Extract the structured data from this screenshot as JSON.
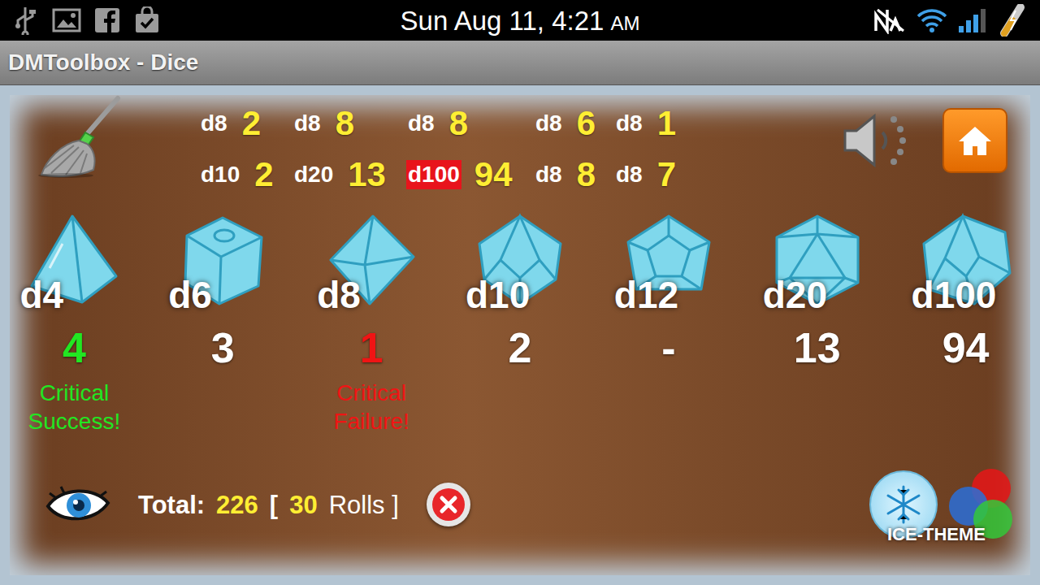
{
  "status_bar": {
    "time": "Sun Aug 11, 4:21",
    "meridiem": "AM"
  },
  "window": {
    "title": "DMToolbox - Dice"
  },
  "history": [
    {
      "die": "d8",
      "value": "2",
      "highlighted": false
    },
    {
      "die": "d8",
      "value": "8",
      "highlighted": false
    },
    {
      "die": "d8",
      "value": "8",
      "highlighted": false
    },
    {
      "die": "d8",
      "value": "6",
      "highlighted": false
    },
    {
      "die": "d8",
      "value": "1",
      "highlighted": false
    },
    {
      "die": "d10",
      "value": "2",
      "highlighted": false
    },
    {
      "die": "d20",
      "value": "13",
      "highlighted": false
    },
    {
      "die": "d100",
      "value": "94",
      "highlighted": true
    },
    {
      "die": "d8",
      "value": "8",
      "highlighted": false
    },
    {
      "die": "d8",
      "value": "7",
      "highlighted": false
    }
  ],
  "dice": [
    {
      "label": "d4",
      "kind": "tetra",
      "result": "4",
      "outcome": "success",
      "message": "Critical Success!"
    },
    {
      "label": "d6",
      "kind": "cube",
      "result": "3",
      "outcome": "normal"
    },
    {
      "label": "d8",
      "kind": "octa",
      "result": "1",
      "outcome": "failure",
      "message": "Critical Failure!"
    },
    {
      "label": "d10",
      "kind": "deca",
      "result": "2",
      "outcome": "normal"
    },
    {
      "label": "d12",
      "kind": "dodeca",
      "result": "-",
      "outcome": "normal"
    },
    {
      "label": "d20",
      "kind": "icosa",
      "result": "13",
      "outcome": "normal"
    },
    {
      "label": "d100",
      "kind": "percentile",
      "result": "94",
      "outcome": "normal"
    }
  ],
  "total": {
    "label": "Total:",
    "value": "226",
    "open": "[",
    "rolls": "30",
    "rolls_label": "Rolls ]"
  },
  "theme": {
    "label": "ICE-THEME"
  }
}
